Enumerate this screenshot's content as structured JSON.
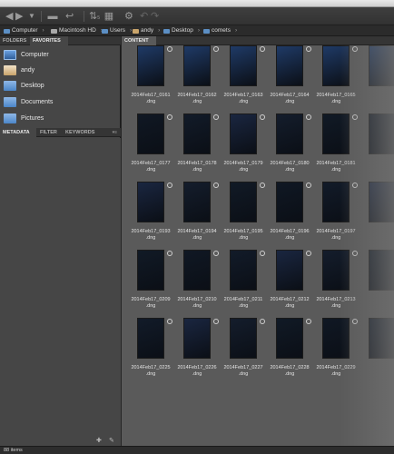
{
  "toolbar": {
    "icons": [
      "back-arrow-icon",
      "forward-arrow-icon",
      "dropdown-icon",
      "recent-folder-icon",
      "boomerang-icon",
      "refine-icon",
      "batch-rename-icon",
      "rotate-left-icon",
      "rotate-right-icon"
    ],
    "badge": "5"
  },
  "path": {
    "items": [
      "Computer",
      "Macintosh HD",
      "Users",
      "andy",
      "Desktop",
      "comets"
    ]
  },
  "left_panel": {
    "tabs": [
      "FOLDERS",
      "FAVORITES"
    ],
    "favorites": [
      "Computer",
      "andy",
      "Desktop",
      "Documents",
      "Pictures"
    ],
    "bottom_tabs": [
      "METADATA",
      "FILTER",
      "KEYWORDS"
    ]
  },
  "content": {
    "tab": "CONTENT",
    "files": [
      "2014Feb17_0161\n.dng",
      "2014Feb17_0162\n.dng",
      "2014Feb17_0163\n.dng",
      "2014Feb17_0164\n.dng",
      "2014Feb17_0165\n.dng",
      "2014Feb17_0177\n.dng",
      "2014Feb17_0178\n.dng",
      "2014Feb17_0179\n.dng",
      "2014Feb17_0180\n.dng",
      "2014Feb17_0181\n.dng",
      "2014Feb17_0193\n.dng",
      "2014Feb17_0194\n.dng",
      "2014Feb17_0195\n.dng",
      "2014Feb17_0196\n.dng",
      "2014Feb17_0197\n.dng",
      "2014Feb17_0209\n.dng",
      "2014Feb17_0210\n.dng",
      "2014Feb17_0211\n.dng",
      "2014Feb17_0212\n.dng",
      "2014Feb17_0213\n.dng",
      "2014Feb17_0225\n.dng",
      "2014Feb17_0226\n.dng",
      "2014Feb17_0227\n.dng",
      "2014Feb17_0228\n.dng",
      "2014Feb17_0229\n.dng"
    ],
    "thumb_colors": [
      "#1f3a66",
      "#141d2c",
      "#111a26",
      "#101824",
      "#121b29",
      "#1a2640"
    ]
  },
  "status": {
    "items": "88 items"
  }
}
